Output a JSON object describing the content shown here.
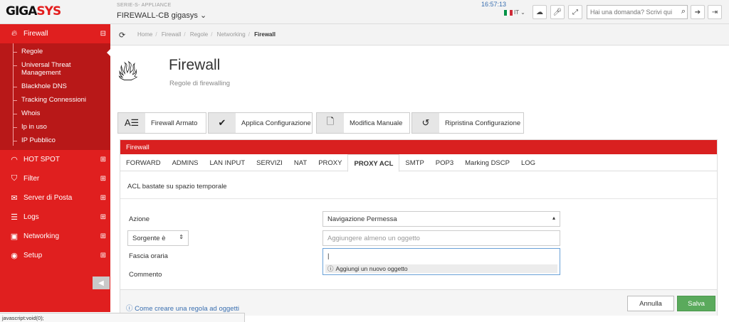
{
  "header": {
    "logo_text_black": "GIGA",
    "logo_text_red": "SYS",
    "appliance_label": "SERIE-S- APPLIANCE",
    "device_name": "FIREWALL-CB gigasys",
    "clock": "16:57:13",
    "language": "IT",
    "search_placeholder": "Hai una domanda? Scrivi qui"
  },
  "sidebar": {
    "items": [
      {
        "label": "Firewall",
        "icon": "flame-icon",
        "toggle": "⊟"
      },
      {
        "label": "HOT SPOT",
        "icon": "wifi-icon",
        "toggle": "⊞"
      },
      {
        "label": "Filter",
        "icon": "shield-icon",
        "toggle": "⊞"
      },
      {
        "label": "Server di Posta",
        "icon": "mail-icon",
        "toggle": "⊞"
      },
      {
        "label": "Logs",
        "icon": "logs-icon",
        "toggle": "⊞"
      },
      {
        "label": "Networking",
        "icon": "network-icon",
        "toggle": "⊞"
      },
      {
        "label": "Setup",
        "icon": "setup-icon",
        "toggle": "⊞"
      }
    ],
    "firewall_sub": [
      "Regole",
      "Universal Threat Management",
      "Blackhole DNS",
      "Tracking Connessioni",
      "Whois",
      "Ip in uso",
      "IP Pubblico"
    ]
  },
  "breadcrumb": [
    "Home",
    "Firewall",
    "Regole",
    "Networking",
    "Firewall"
  ],
  "page": {
    "title": "Firewall",
    "subtitle": "Regole di firewalling"
  },
  "actions": [
    {
      "label": "Firewall Armato",
      "icon": "rule-icon"
    },
    {
      "label": "Applica Configurazione",
      "icon": "check-icon"
    },
    {
      "label": "Modifica Manuale",
      "icon": "document-icon"
    },
    {
      "label": "Ripristina Configurazione",
      "icon": "restore-icon"
    }
  ],
  "panel": {
    "title": "Firewall",
    "tabs": [
      "FORWARD",
      "ADMINS",
      "LAN INPUT",
      "SERVIZI",
      "NAT",
      "PROXY",
      "PROXY ACL",
      "SMTP",
      "POP3",
      "Marking DSCP",
      "LOG"
    ],
    "active_tab": "PROXY ACL",
    "description": "ACL bastate su spazio temporale",
    "form": {
      "azione_label": "Azione",
      "azione_value": "Navigazione Permessa",
      "sorgente_value": "Sorgente è",
      "sorgente_placeholder": "Aggiungere almeno un oggetto",
      "fascia_label": "Fascia oraria",
      "fascia_value": "|",
      "dropdown_option": "Aggiungi un nuovo oggetto",
      "commento_label": "Commento"
    },
    "help_link": "Come creare una regola ad oggetti",
    "cancel_label": "Annulla",
    "save_label": "Salva"
  },
  "status_bar": "javascript:void(0);",
  "colors": {
    "brand_red": "#e01f1f",
    "submenu_red": "#b81818",
    "save_green": "#5aaa5c",
    "link_blue": "#3a6fb0"
  }
}
